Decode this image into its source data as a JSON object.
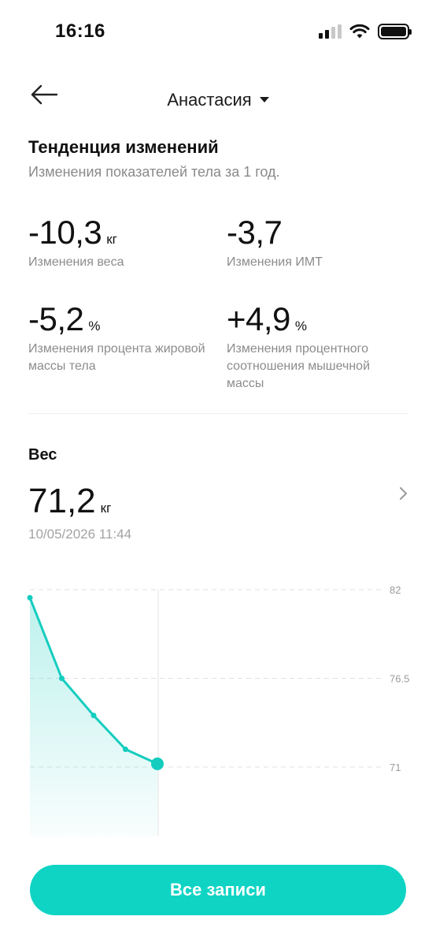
{
  "status_bar": {
    "time": "16:16"
  },
  "header": {
    "user_name": "Анастасия"
  },
  "trend": {
    "title": "Тенденция изменений",
    "subtitle": "Изменения показателей тела за 1 год.",
    "metrics": [
      {
        "value": "-10,3",
        "unit": "кг",
        "label": "Изменения веса"
      },
      {
        "value": "-3,7",
        "unit": "",
        "label": "Изменения ИМТ"
      },
      {
        "value": "-5,2",
        "unit": "%",
        "label": "Изменения процента жировой массы тела"
      },
      {
        "value": "+4,9",
        "unit": "%",
        "label": "Изменения процентного соотношения мышечной массы"
      }
    ]
  },
  "weight": {
    "title": "Вес",
    "value": "71,2",
    "unit": "кг",
    "date": "10/05/2026 11:44"
  },
  "chart_data": {
    "type": "area",
    "y_ticks": [
      "82",
      "76.5",
      "71"
    ],
    "ylim": [
      71,
      82
    ],
    "values": [
      81.5,
      76.5,
      74.2,
      72.1,
      71.2
    ],
    "grid": true,
    "line_color": "#14cdbf",
    "fill_color": "#d6f5f2"
  },
  "actions": {
    "all_records_label": "Все записи"
  },
  "colors": {
    "accent": "#0fd4c4",
    "text_primary": "#111111",
    "text_secondary": "#8c8c8c"
  }
}
